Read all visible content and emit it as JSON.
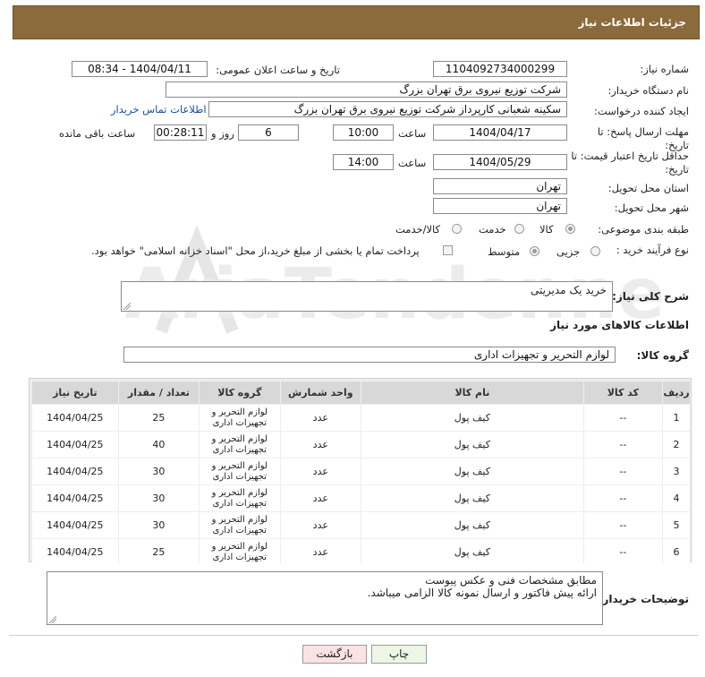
{
  "header": {
    "title": "جزئیات اطلاعات نیاز"
  },
  "fields": {
    "need_number_label": "شماره نیاز:",
    "need_number": "1104092734000299",
    "announce_label": "تاریخ و ساعت اعلان عمومی:",
    "announce_value": "1404/04/11 - 08:34",
    "buyer_org_label": "نام دستگاه خریدار:",
    "buyer_org": "شرکت توزیع نیروی برق تهران بزرگ",
    "requester_label": "ایجاد کننده درخواست:",
    "requester": "سکینه شعبانی کارپرداز شرکت توزیع نیروی برق تهران بزرگ",
    "contact_link": "اطلاعات تماس خریدار",
    "reply_deadline_label": "مهلت ارسال پاسخ: تا تاریخ:",
    "reply_date": "1404/04/17",
    "time_label": "ساعت",
    "reply_time": "10:00",
    "days": "6",
    "days_label": "روز و",
    "remaining": "00:28:11",
    "remaining_label": "ساعت باقی مانده",
    "price_validity_label": "حداقل تاریخ اعتبار قیمت: تا تاریخ:",
    "validity_date": "1404/05/29",
    "validity_time": "14:00",
    "province_label": "استان محل تحویل:",
    "province": "تهران",
    "city_label": "شهر محل تحویل:",
    "city": "تهران",
    "category_label": "طبقه بندی موضوعی:",
    "category_options": [
      "کالا",
      "خدمت",
      "کالا/خدمت"
    ],
    "process_label": "نوع فرآیند خرید :",
    "process_options": [
      "جزیی",
      "متوسط"
    ],
    "payment_note": "پرداخت تمام یا بخشی از مبلغ خرید،از محل \"اسناد خزانه اسلامی\" خواهد بود.",
    "summary_label": "شرح کلی نیاز:",
    "summary": "خرید یک مدیریتی",
    "goods_info_title": "اطلاعات کالاهای مورد نیاز",
    "goods_group_label": "گروه کالا:",
    "goods_group": "لوازم التحریر و تجهیزات اداری"
  },
  "table": {
    "headers": [
      "ردیف",
      "کد کالا",
      "نام کالا",
      "واحد شمارش",
      "گروه کالا",
      "تعداد / مقدار",
      "تاریخ نیاز"
    ],
    "rows": [
      [
        "1",
        "--",
        "کیف پول",
        "عدد",
        "لوازم التحریر و تجهیزات اداری",
        "25",
        "1404/04/25"
      ],
      [
        "2",
        "--",
        "کیف پول",
        "عدد",
        "لوازم التحریر و تجهیزات اداری",
        "40",
        "1404/04/25"
      ],
      [
        "3",
        "--",
        "کیف پول",
        "عدد",
        "لوازم التحریر و تجهیزات اداری",
        "30",
        "1404/04/25"
      ],
      [
        "4",
        "--",
        "کیف پول",
        "عدد",
        "لوازم التحریر و تجهیزات اداری",
        "30",
        "1404/04/25"
      ],
      [
        "5",
        "--",
        "کیف پول",
        "عدد",
        "لوازم التحریر و تجهیزات اداری",
        "30",
        "1404/04/25"
      ],
      [
        "6",
        "--",
        "کیف پول",
        "عدد",
        "لوازم التحریر و تجهیزات اداری",
        "25",
        "1404/04/25"
      ]
    ]
  },
  "notes": {
    "label": "توضیحات خریدار:",
    "lines": [
      "مطابق مشخصات فنی و عکس پیوست",
      "ارائه پیش فاکتور و ارسال نمونه کالا الزامی میباشد."
    ]
  },
  "buttons": {
    "print": "چاپ",
    "back": "بازگشت"
  },
  "watermark": "AriaTender.net",
  "colors": {
    "header_bg": "#8b6b3b",
    "link": "#1a4fa3",
    "back_button": "#fbe3e3",
    "print_button": "#eef6e6"
  }
}
